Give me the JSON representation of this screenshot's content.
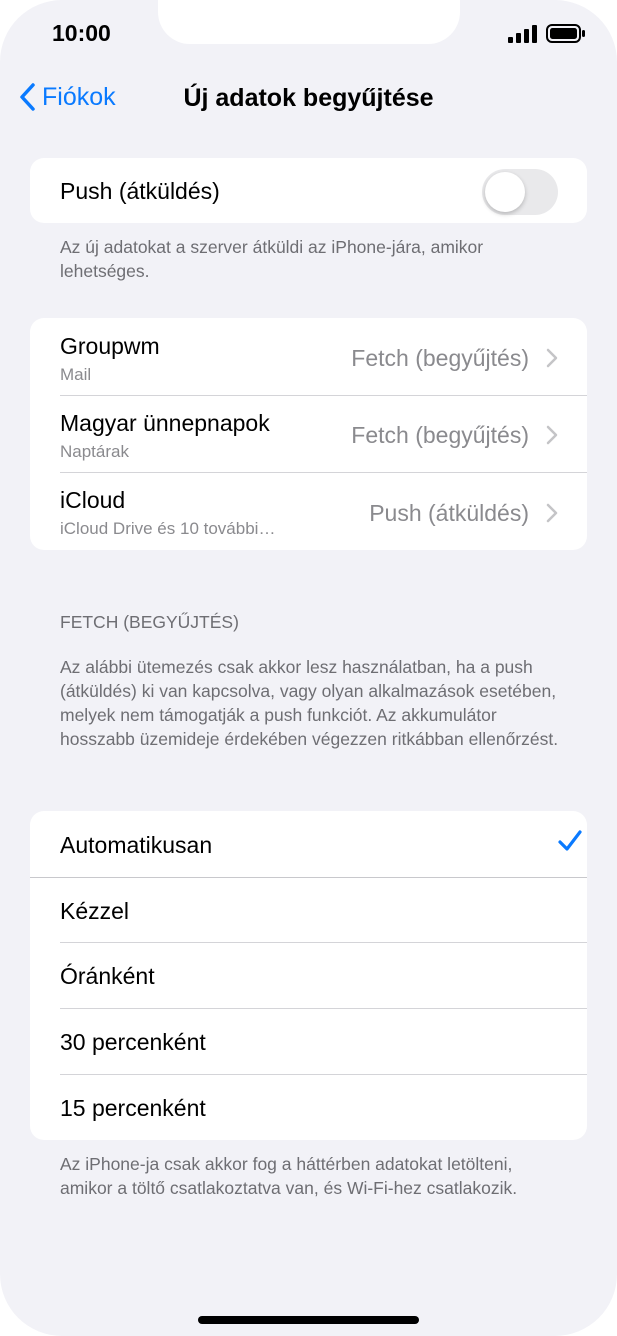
{
  "status_bar": {
    "time": "10:00",
    "signal_icon": "signal-icon",
    "battery_icon": "battery-icon"
  },
  "nav": {
    "back_label": "Fiókok",
    "title": "Új adatok begyűjtése"
  },
  "push": {
    "label": "Push (átküldés)",
    "toggle_on": false,
    "footnote": "Az új adatokat a szerver átküldi az iPhone-jára, amikor lehetséges."
  },
  "accounts": [
    {
      "name": "Groupwm",
      "subtitle": "Mail",
      "value": "Fetch (begyűjtés)"
    },
    {
      "name": "Magyar ünnepnapok",
      "subtitle": "Naptárak",
      "value": "Fetch (begyűjtés)"
    },
    {
      "name": "iCloud",
      "subtitle": "iCloud Drive és 10 további…",
      "value": "Push (átküldés)"
    }
  ],
  "fetch_section": {
    "header": "FETCH (BEGYŰJTÉS)",
    "description": "Az alábbi ütemezés csak akkor lesz használatban, ha a push (átküldés) ki van kapcsolva, vagy olyan alkalmazások esetében, melyek nem támogatják a push funkciót. Az akkumulátor hosszabb üzemideje érdekében végezzen ritkábban ellenőrzést."
  },
  "schedule_options": [
    {
      "label": "Automatikusan",
      "selected": true
    },
    {
      "label": "Kézzel",
      "selected": false
    },
    {
      "label": "Óránként",
      "selected": false
    },
    {
      "label": "30 percenként",
      "selected": false
    },
    {
      "label": "15 percenként",
      "selected": false
    }
  ],
  "bottom_footnote": "Az iPhone-ja csak akkor fog a háttérben adatokat letölteni, amikor a töltő csatlakoztatva van, és Wi-Fi-hez csatlakozik.",
  "colors": {
    "accent": "#0a7aff",
    "background": "#f2f2f7",
    "secondary_text": "#8a8a8e"
  }
}
